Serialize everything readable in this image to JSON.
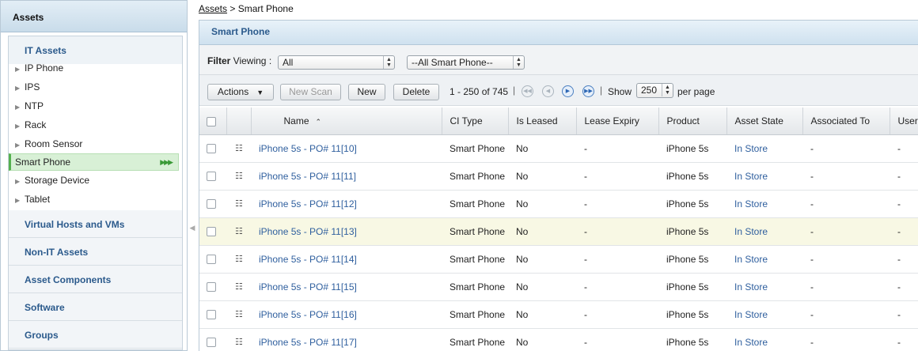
{
  "sidebar": {
    "header": "Assets",
    "open_category": "IT Assets",
    "partial_item": "IP Phone",
    "items": [
      {
        "label": "IPS"
      },
      {
        "label": "NTP"
      },
      {
        "label": "Rack"
      },
      {
        "label": "Room Sensor"
      },
      {
        "label": "Smart Phone",
        "selected": true
      },
      {
        "label": "Storage Device"
      },
      {
        "label": "Tablet"
      }
    ],
    "categories": [
      "Virtual Hosts and VMs",
      "Non-IT Assets",
      "Asset Components",
      "Software",
      "Groups"
    ]
  },
  "breadcrumb": {
    "root": "Assets",
    "separator": " > ",
    "current": "Smart Phone"
  },
  "main": {
    "title": "Smart Phone"
  },
  "filter": {
    "label_bold": "Filter",
    "label_rest": " Viewing :",
    "viewing_value": "All",
    "type_value": "--All Smart Phone--"
  },
  "toolbar": {
    "actions_label": "Actions",
    "new_scan_label": "New Scan",
    "new_label": "New",
    "delete_label": "Delete",
    "range_text": "1 - 250 of 745",
    "show_label": "Show",
    "per_page_value": "250",
    "per_page_label": "per page"
  },
  "table": {
    "columns": [
      "Name",
      "CI Type",
      "Is Leased",
      "Lease Expiry",
      "Product",
      "Asset State",
      "Associated To",
      "User"
    ],
    "sorted_by": "Name",
    "rows": [
      {
        "name": "iPhone 5s - PO# 11[10]",
        "ci_type": "Smart Phone",
        "is_leased": "No",
        "lease_expiry": "-",
        "product": "iPhone 5s",
        "asset_state": "In Store",
        "associated_to": "-",
        "user": "-"
      },
      {
        "name": "iPhone 5s - PO# 11[11]",
        "ci_type": "Smart Phone",
        "is_leased": "No",
        "lease_expiry": "-",
        "product": "iPhone 5s",
        "asset_state": "In Store",
        "associated_to": "-",
        "user": "-"
      },
      {
        "name": "iPhone 5s - PO# 11[12]",
        "ci_type": "Smart Phone",
        "is_leased": "No",
        "lease_expiry": "-",
        "product": "iPhone 5s",
        "asset_state": "In Store",
        "associated_to": "-",
        "user": "-"
      },
      {
        "name": "iPhone 5s - PO# 11[13]",
        "ci_type": "Smart Phone",
        "is_leased": "No",
        "lease_expiry": "-",
        "product": "iPhone 5s",
        "asset_state": "In Store",
        "associated_to": "-",
        "user": "-",
        "highlighted": true
      },
      {
        "name": "iPhone 5s - PO# 11[14]",
        "ci_type": "Smart Phone",
        "is_leased": "No",
        "lease_expiry": "-",
        "product": "iPhone 5s",
        "asset_state": "In Store",
        "associated_to": "-",
        "user": "-"
      },
      {
        "name": "iPhone 5s - PO# 11[15]",
        "ci_type": "Smart Phone",
        "is_leased": "No",
        "lease_expiry": "-",
        "product": "iPhone 5s",
        "asset_state": "In Store",
        "associated_to": "-",
        "user": "-"
      },
      {
        "name": "iPhone 5s - PO# 11[16]",
        "ci_type": "Smart Phone",
        "is_leased": "No",
        "lease_expiry": "-",
        "product": "iPhone 5s",
        "asset_state": "In Store",
        "associated_to": "-",
        "user": "-"
      },
      {
        "name": "iPhone 5s - PO# 11[17]",
        "ci_type": "Smart Phone",
        "is_leased": "No",
        "lease_expiry": "-",
        "product": "iPhone 5s",
        "asset_state": "In Store",
        "associated_to": "-",
        "user": "-"
      }
    ]
  },
  "icons": {
    "tree_arrow": "triangle-right-icon",
    "selected_marker": "fast-forward-icon",
    "row_icon": "hierarchy-icon",
    "sort": "sort-ascending-icon",
    "select_stepper": "up-down-arrows-icon",
    "pager_first": "first-page-icon",
    "pager_prev": "previous-page-icon",
    "pager_next": "next-page-icon",
    "pager_last": "last-page-icon"
  },
  "colors": {
    "link": "#2f5f9e",
    "selected_bg": "#d8f0d6",
    "row_highlight": "#f8f8e4",
    "header_blue": "#2b5a8c"
  }
}
